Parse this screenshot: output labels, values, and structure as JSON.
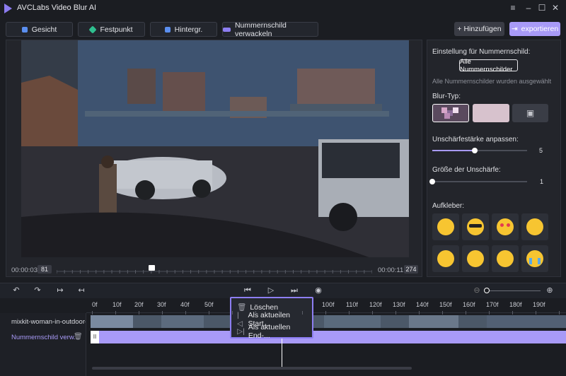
{
  "app": {
    "title": "AVCLabs Video Blur AI"
  },
  "window": {
    "menu_icon": "menu-icon",
    "min_icon": "minimize-icon",
    "max_icon": "maximize-icon",
    "close_icon": "close-icon"
  },
  "modes": [
    {
      "label": "Gesicht",
      "icon": "face-icon",
      "color": "#5b8ff0"
    },
    {
      "label": "Festpunkt",
      "icon": "point-icon",
      "color": "#2fbf8f"
    },
    {
      "label": "Hintergr.",
      "icon": "background-icon",
      "color": "#5b8ff0"
    },
    {
      "label": "Nummernschild verwackeln",
      "icon": "plate-icon",
      "color": "#8d7ef2"
    }
  ],
  "toolbar": {
    "add_label": "+ Hinzufügen",
    "export_label": "exportieren"
  },
  "player": {
    "time_current": "00:00:03",
    "frame_current": "81",
    "time_end": "00:00:11",
    "frame_end": "274",
    "progress": 0.3
  },
  "side": {
    "setting_title": "Einstellung für Nummernschild:",
    "all_plates_button": "Alle Nummernschilder",
    "selected_note": "Alle Nummernschilder wurden ausgewählt",
    "blur_type_label": "Blur-Typ:",
    "strength_label": "Unschärfestärke anpassen:",
    "strength_value": "5",
    "strength_fraction": 0.45,
    "size_label": "Größe der Unschärfe:",
    "size_value": "1",
    "size_fraction": 0.0,
    "sticker_label": "Aufkleber:"
  },
  "stickers": [
    "smile-emoji",
    "sunglasses-emoji",
    "heart-eyes-emoji",
    "neutral-emoji",
    "tongue-wink-emoji",
    "eye-roll-emoji",
    "grimace-emoji",
    "crying-emoji"
  ],
  "timeline": {
    "ruler": [
      "0f",
      "10f",
      "20f",
      "30f",
      "40f",
      "50f",
      "100f",
      "110f",
      "120f",
      "130f",
      "140f",
      "150f",
      "160f",
      "170f",
      "180f",
      "190f"
    ],
    "video_track_name": "mixkit-woman-in-outdoor-p",
    "plate_track_name": "Nummernschild verw...",
    "accent": "#a89af7"
  },
  "context_menu": {
    "items": [
      "Löschen",
      "Als aktuellen Start...",
      "Als aktuellen End-..."
    ]
  }
}
